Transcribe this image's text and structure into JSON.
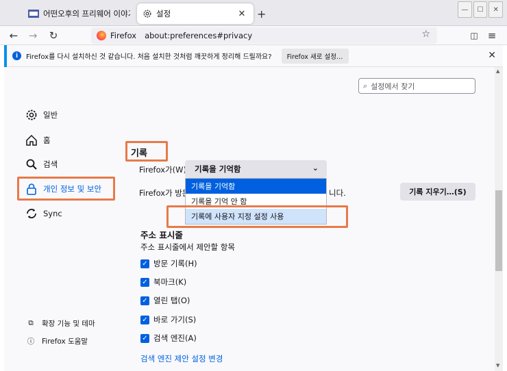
{
  "tabs": [
    {
      "title": "어떤오후의 프리웨어 이야기",
      "close": "✕"
    },
    {
      "title": "설정",
      "close": "✕"
    }
  ],
  "new_tab": "+",
  "window_controls": {
    "minimize": "—",
    "maximize": "☐",
    "close": "✕"
  },
  "nav": {
    "back": "←",
    "forward": "→",
    "reload": "↻",
    "brand": "Firefox",
    "url": "about:preferences#privacy",
    "star": "☆",
    "pocket": "◫",
    "menu": "≡"
  },
  "notification": {
    "message": "Firefox를 다시 설치하신 것 같습니다. 처음 설치한 것처럼 깨끗하게 정리해 드릴까요?",
    "button": "Firefox 새로 설정…",
    "close": "✕"
  },
  "search": {
    "placeholder": "설정에서 찾기"
  },
  "categories": [
    {
      "label": "일반"
    },
    {
      "label": "홈"
    },
    {
      "label": "검색"
    },
    {
      "label": "개인 정보 및 보안"
    },
    {
      "label": "Sync"
    }
  ],
  "footer": [
    {
      "label": "확장 기능 및 테마"
    },
    {
      "label": "Firefox 도움말"
    }
  ],
  "history": {
    "title": "기록",
    "firefox_will_label": "Firefox가(W)",
    "visit_text_left": "Firefox가 방문",
    "visit_text_right": "니다.",
    "dropdown_value": "기록을 기억함",
    "chevron": "⌄",
    "options": [
      "기록을 기억함",
      "기록을 기억 안 함",
      "기록에 사용자 지정 설정 사용"
    ],
    "clear_button": "기록 지우기…(S)"
  },
  "address_bar": {
    "title": "주소 표시줄",
    "subtitle": "주소 표시줄에서 제안할 항목",
    "checkboxes": [
      {
        "label": "방문 기록(H)",
        "checked": true
      },
      {
        "label": "북마크(K)",
        "checked": true
      },
      {
        "label": "열린 탭(O)",
        "checked": true
      },
      {
        "label": "바로 가기(S)",
        "checked": true
      },
      {
        "label": "검색 엔진(A)",
        "checked": true
      }
    ],
    "link": "검색 엔진 제안 설정 변경"
  },
  "colors": {
    "accent": "#0061e0",
    "highlight": "#e8794a",
    "selected_option": "#0060df"
  }
}
